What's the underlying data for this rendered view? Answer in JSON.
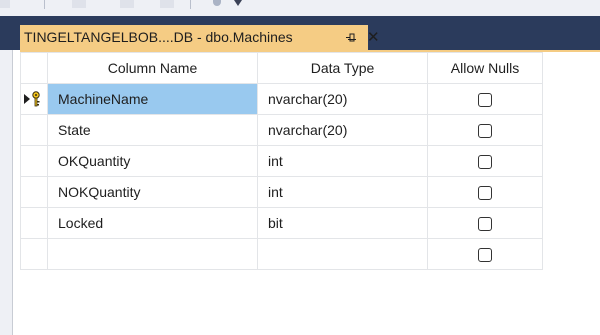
{
  "tab": {
    "title": "TINGELTANGELBOB....DB - dbo.Machines",
    "pin_icon": "pin-icon",
    "close_glyph": "✕"
  },
  "grid": {
    "headers": [
      "Column Name",
      "Data Type",
      "Allow Nulls"
    ],
    "rows": [
      {
        "name": "MachineName",
        "type": "nvarchar(20)",
        "allow_nulls": false,
        "primary_key": true,
        "selected": true
      },
      {
        "name": "State",
        "type": "nvarchar(20)",
        "allow_nulls": false
      },
      {
        "name": "OKQuantity",
        "type": "int",
        "allow_nulls": false
      },
      {
        "name": "NOKQuantity",
        "type": "int",
        "allow_nulls": false
      },
      {
        "name": "Locked",
        "type": "bit",
        "allow_nulls": false
      },
      {
        "name": "",
        "type": "",
        "allow_nulls": false
      }
    ]
  },
  "colors": {
    "tab_well": "#2b3b5c",
    "active_tab": "#f5cc84",
    "selected_cell": "#99c9ef"
  }
}
